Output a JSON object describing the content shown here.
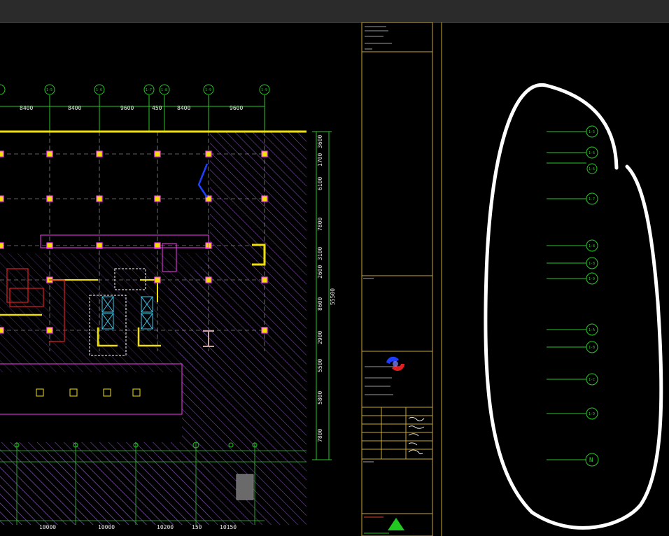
{
  "toolbar": {
    "label": ""
  },
  "drawing": {
    "top_dimensions": [
      "8400",
      "8400",
      "9600",
      "450",
      "8400",
      "9600"
    ],
    "top_axis_labels": [
      "1-5",
      "1-5",
      "1-6",
      "1-7",
      "1-8",
      "1-9",
      "1-9"
    ],
    "right_dimensions": [
      "3600",
      "1700",
      "6100",
      "7800",
      "3100",
      "2600",
      "8600",
      "2900",
      "5500",
      "5800",
      "7800"
    ],
    "right_total_dimension": "55500",
    "bottom_dimensions": [
      "10000",
      "10000",
      "10200",
      "150",
      "10150"
    ]
  },
  "title_block": {
    "company_line": "",
    "stamp_label": "",
    "footer_label": ""
  },
  "axis_panel": {
    "labels": [
      "1-5",
      "1-6",
      "1-6",
      "1-7",
      "1-8",
      "1-8",
      "1-9",
      "1-A",
      "1-B",
      "1-C",
      "1-D",
      "1-E",
      "N"
    ]
  },
  "colors": {
    "background": "#000000",
    "grid_green": "#28c828",
    "wall_yellow": "#f0e000",
    "column_magenta": "#ff3cff",
    "hatch_purple": "#7a4aa8",
    "sheet_border": "#c8a830",
    "annotation_white": "#ffffff"
  }
}
